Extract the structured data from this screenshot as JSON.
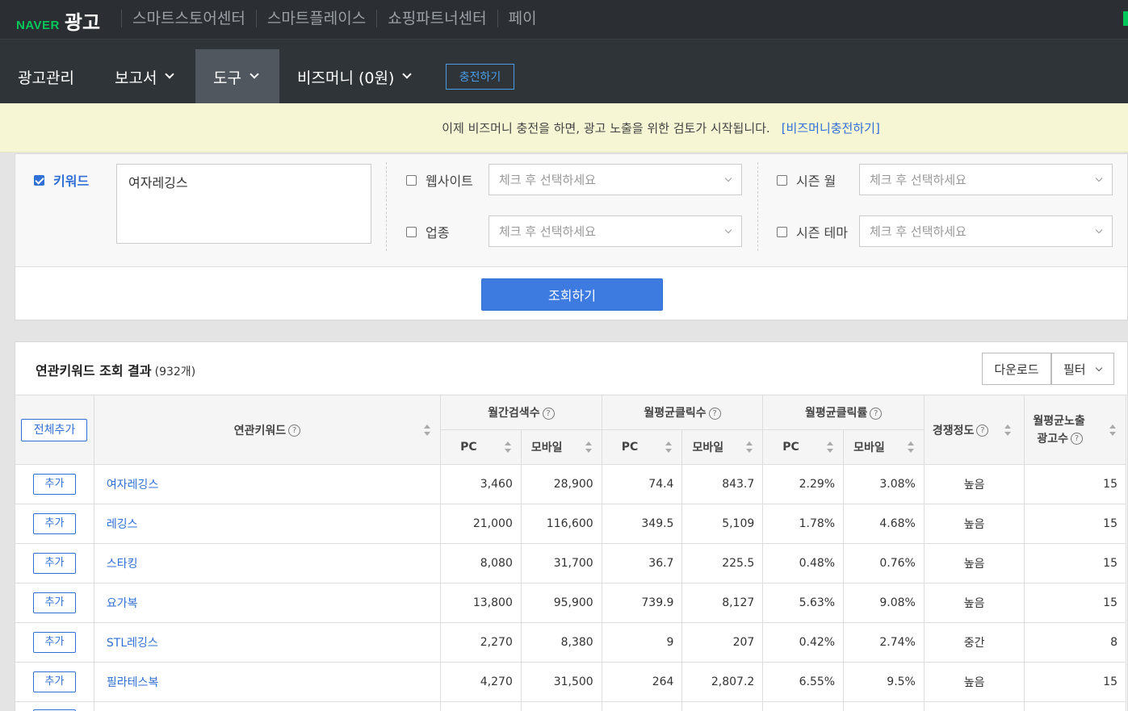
{
  "topbar": {
    "brand_naver": "NAVER",
    "brand_ad": "광고",
    "links": [
      "스마트스토어센터",
      "스마트플레이스",
      "쇼핑파트너센터",
      "페이"
    ]
  },
  "mainnav": {
    "ad_manage": "광고관리",
    "report": "보고서",
    "tools": "도구",
    "bizmoney": "비즈머니 (0원)",
    "charge": "충전하기"
  },
  "notice": {
    "text": "이제 비즈머니 충전을 하면, 광고 노출을 위한 검토가 시작됩니다.",
    "link": "[비즈머니충전하기]"
  },
  "filters": {
    "keyword_label": "키워드",
    "keyword_value": "여자레깅스",
    "website_label": "웹사이트",
    "industry_label": "업종",
    "season_month_label": "시즌 월",
    "season_theme_label": "시즌 테마",
    "select_placeholder": "체크 후 선택하세요",
    "search_button": "조회하기"
  },
  "results": {
    "title": "연관키워드 조회 결과",
    "count": "(932개)",
    "download": "다운로드",
    "filter": "필터",
    "headers": {
      "add_all": "전체추가",
      "keyword": "연관키워드",
      "monthly_search": "월간검색수",
      "avg_clicks": "월평균클릭수",
      "avg_ctr": "월평균클릭률",
      "competition": "경쟁정도",
      "avg_ads_1": "월평균노출",
      "avg_ads_2": "광고수",
      "pc": "PC",
      "mobile": "모바일",
      "help": "?"
    },
    "add_label": "추가",
    "rows": [
      {
        "keyword": "여자레깅스",
        "pc_search": "3,460",
        "mobile_search": "28,900",
        "pc_clicks": "74.4",
        "mobile_clicks": "843.7",
        "pc_ctr": "2.29%",
        "mobile_ctr": "3.08%",
        "competition": "높음",
        "ads": "15"
      },
      {
        "keyword": "레깅스",
        "pc_search": "21,000",
        "mobile_search": "116,600",
        "pc_clicks": "349.5",
        "mobile_clicks": "5,109",
        "pc_ctr": "1.78%",
        "mobile_ctr": "4.68%",
        "competition": "높음",
        "ads": "15"
      },
      {
        "keyword": "스타킹",
        "pc_search": "8,080",
        "mobile_search": "31,700",
        "pc_clicks": "36.7",
        "mobile_clicks": "225.5",
        "pc_ctr": "0.48%",
        "mobile_ctr": "0.76%",
        "competition": "높음",
        "ads": "15"
      },
      {
        "keyword": "요가복",
        "pc_search": "13,800",
        "mobile_search": "95,900",
        "pc_clicks": "739.9",
        "mobile_clicks": "8,127",
        "pc_ctr": "5.63%",
        "mobile_ctr": "9.08%",
        "competition": "높음",
        "ads": "15"
      },
      {
        "keyword": "STL레깅스",
        "pc_search": "2,270",
        "mobile_search": "8,380",
        "pc_clicks": "9",
        "mobile_clicks": "207",
        "pc_ctr": "0.42%",
        "mobile_ctr": "2.74%",
        "competition": "중간",
        "ads": "8"
      },
      {
        "keyword": "필라테스복",
        "pc_search": "4,270",
        "mobile_search": "31,500",
        "pc_clicks": "264",
        "mobile_clicks": "2,807.2",
        "pc_ctr": "6.55%",
        "mobile_ctr": "9.5%",
        "competition": "높음",
        "ads": "15"
      }
    ]
  },
  "colors": {
    "accent": "#2f6fd6",
    "brand_green": "#03c75a",
    "topbar": "#2b2f33"
  }
}
